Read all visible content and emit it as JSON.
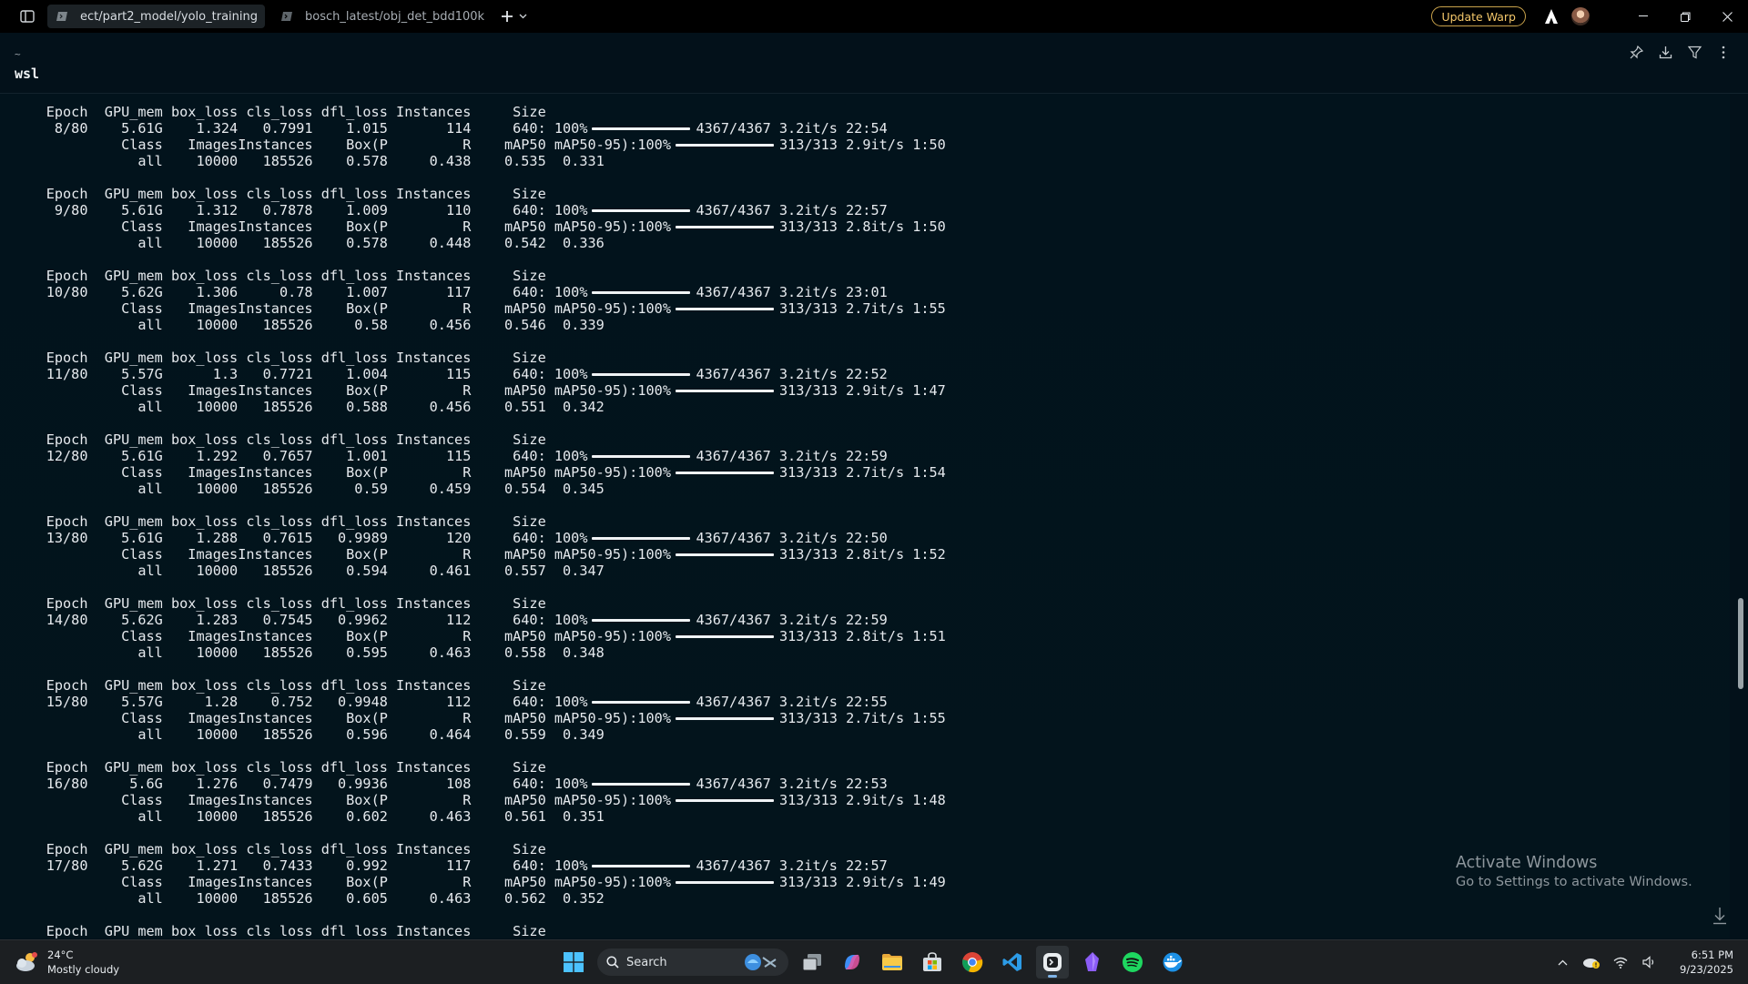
{
  "titlebar": {
    "tabs": [
      {
        "label": "ect/part2_model/yolo_training",
        "active": true
      },
      {
        "label": "bosch_latest/obj_det_bdd100k",
        "active": false
      }
    ],
    "update_label": "Update Warp"
  },
  "block": {
    "cwd": "~",
    "command": "wsl"
  },
  "training_log": {
    "train_header": [
      "Epoch",
      "GPU_mem",
      "box_loss",
      "cls_loss",
      "dfl_loss",
      "Instances",
      "Size"
    ],
    "val_header": [
      "Class",
      "Images",
      "Instances",
      "Box(P",
      "R",
      "mAP50",
      "mAP50-95):"
    ],
    "val_class": "all",
    "train_progress": {
      "percent": "100%",
      "count": "4367/4367"
    },
    "val_progress": {
      "percent": "100%",
      "count": "313/313"
    },
    "epochs": [
      {
        "epoch": "8/80",
        "gpu_mem": "5.61G",
        "box_loss": "1.324",
        "cls_loss": "0.7991",
        "dfl_loss": "1.015",
        "instances": "114",
        "size": "640:",
        "train_rate": "3.2it/s 22:54",
        "val_rate": "2.9it/s 1:50",
        "images": "10000",
        "val_instances": "185526",
        "box_p": "0.578",
        "r": "0.438",
        "map50": "0.535",
        "map50_95": "0.331"
      },
      {
        "epoch": "9/80",
        "gpu_mem": "5.61G",
        "box_loss": "1.312",
        "cls_loss": "0.7878",
        "dfl_loss": "1.009",
        "instances": "110",
        "size": "640:",
        "train_rate": "3.2it/s 22:57",
        "val_rate": "2.8it/s 1:50",
        "images": "10000",
        "val_instances": "185526",
        "box_p": "0.578",
        "r": "0.448",
        "map50": "0.542",
        "map50_95": "0.336"
      },
      {
        "epoch": "10/80",
        "gpu_mem": "5.62G",
        "box_loss": "1.306",
        "cls_loss": "0.78",
        "dfl_loss": "1.007",
        "instances": "117",
        "size": "640:",
        "train_rate": "3.2it/s 23:01",
        "val_rate": "2.7it/s 1:55",
        "images": "10000",
        "val_instances": "185526",
        "box_p": "0.58",
        "r": "0.456",
        "map50": "0.546",
        "map50_95": "0.339"
      },
      {
        "epoch": "11/80",
        "gpu_mem": "5.57G",
        "box_loss": "1.3",
        "cls_loss": "0.7721",
        "dfl_loss": "1.004",
        "instances": "115",
        "size": "640:",
        "train_rate": "3.2it/s 22:52",
        "val_rate": "2.9it/s 1:47",
        "images": "10000",
        "val_instances": "185526",
        "box_p": "0.588",
        "r": "0.456",
        "map50": "0.551",
        "map50_95": "0.342"
      },
      {
        "epoch": "12/80",
        "gpu_mem": "5.61G",
        "box_loss": "1.292",
        "cls_loss": "0.7657",
        "dfl_loss": "1.001",
        "instances": "115",
        "size": "640:",
        "train_rate": "3.2it/s 22:59",
        "val_rate": "2.7it/s 1:54",
        "images": "10000",
        "val_instances": "185526",
        "box_p": "0.59",
        "r": "0.459",
        "map50": "0.554",
        "map50_95": "0.345"
      },
      {
        "epoch": "13/80",
        "gpu_mem": "5.61G",
        "box_loss": "1.288",
        "cls_loss": "0.7615",
        "dfl_loss": "0.9989",
        "instances": "120",
        "size": "640:",
        "train_rate": "3.2it/s 22:50",
        "val_rate": "2.8it/s 1:52",
        "images": "10000",
        "val_instances": "185526",
        "box_p": "0.594",
        "r": "0.461",
        "map50": "0.557",
        "map50_95": "0.347"
      },
      {
        "epoch": "14/80",
        "gpu_mem": "5.62G",
        "box_loss": "1.283",
        "cls_loss": "0.7545",
        "dfl_loss": "0.9962",
        "instances": "112",
        "size": "640:",
        "train_rate": "3.2it/s 22:59",
        "val_rate": "2.8it/s 1:51",
        "images": "10000",
        "val_instances": "185526",
        "box_p": "0.595",
        "r": "0.463",
        "map50": "0.558",
        "map50_95": "0.348"
      },
      {
        "epoch": "15/80",
        "gpu_mem": "5.57G",
        "box_loss": "1.28",
        "cls_loss": "0.752",
        "dfl_loss": "0.9948",
        "instances": "112",
        "size": "640:",
        "train_rate": "3.2it/s 22:55",
        "val_rate": "2.7it/s 1:55",
        "images": "10000",
        "val_instances": "185526",
        "box_p": "0.596",
        "r": "0.464",
        "map50": "0.559",
        "map50_95": "0.349"
      },
      {
        "epoch": "16/80",
        "gpu_mem": "5.6G",
        "box_loss": "1.276",
        "cls_loss": "0.7479",
        "dfl_loss": "0.9936",
        "instances": "108",
        "size": "640:",
        "train_rate": "3.2it/s 22:53",
        "val_rate": "2.9it/s 1:48",
        "images": "10000",
        "val_instances": "185526",
        "box_p": "0.602",
        "r": "0.463",
        "map50": "0.561",
        "map50_95": "0.351"
      },
      {
        "epoch": "17/80",
        "gpu_mem": "5.62G",
        "box_loss": "1.271",
        "cls_loss": "0.7433",
        "dfl_loss": "0.992",
        "instances": "117",
        "size": "640:",
        "train_rate": "3.2it/s 22:57",
        "val_rate": "2.9it/s 1:49",
        "images": "10000",
        "val_instances": "185526",
        "box_p": "0.605",
        "r": "0.463",
        "map50": "0.562",
        "map50_95": "0.352"
      }
    ]
  },
  "watermark": {
    "title": "Activate Windows",
    "subtitle": "Go to Settings to activate Windows."
  },
  "taskbar": {
    "weather_temp": "24°C",
    "weather_desc": "Mostly cloudy",
    "search_label": "Search",
    "time": "6:51 PM",
    "date": "9/23/2025"
  },
  "colors": {
    "terminal_bg": "#03111a",
    "text": "#e6eaee",
    "accent_update": "#f4c76a"
  }
}
